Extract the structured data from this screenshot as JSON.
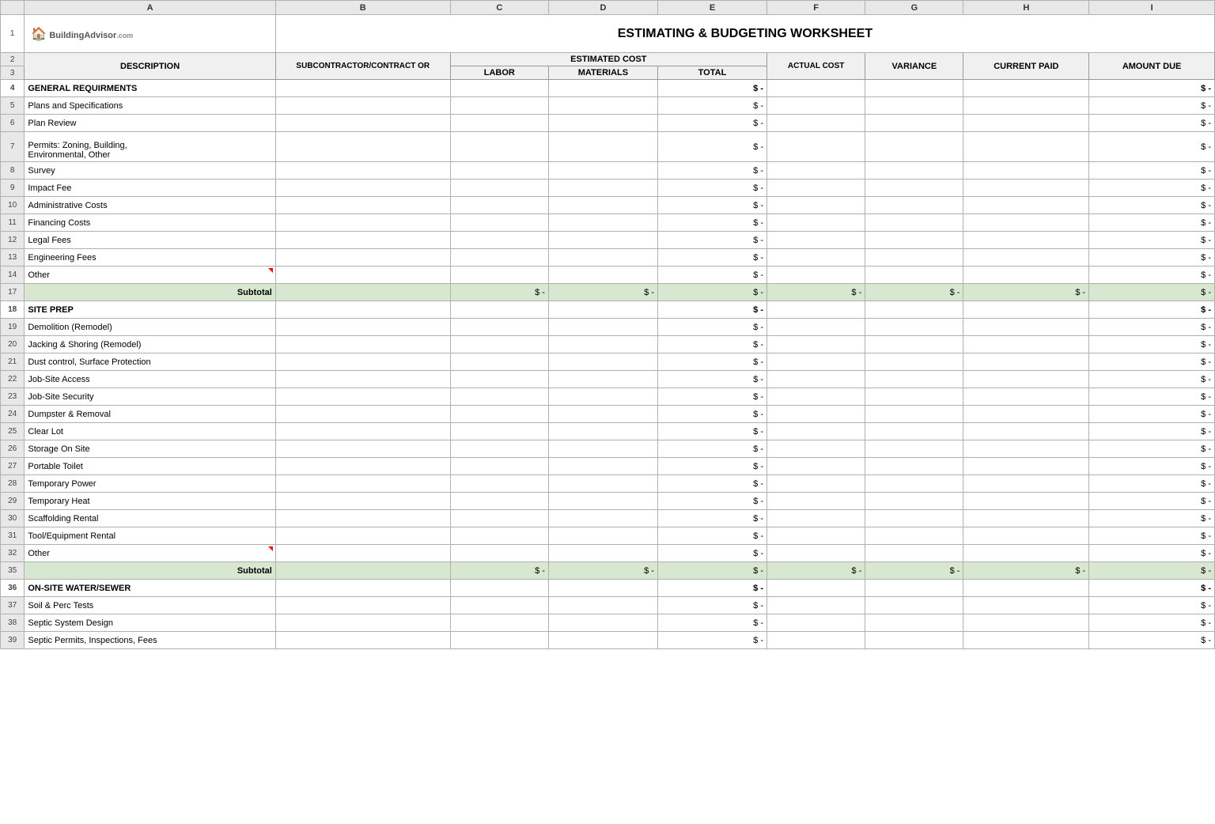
{
  "title": "ESTIMATING & BUDGETING WORKSHEET",
  "logo": {
    "text": "BuildingAdvisor",
    "tld": ".com"
  },
  "columns": {
    "letters": [
      "",
      "A",
      "B",
      "C",
      "D",
      "E",
      "F",
      "G",
      "H",
      "I"
    ],
    "headers": {
      "description": "DESCRIPTION",
      "subcontractor": "SUBCONTRACTOR/CONTRACT OR",
      "estimated_cost": "ESTIMATED COST",
      "labor": "LABOR",
      "materials": "MATERIALS",
      "total": "TOTAL",
      "actual_cost": "ACTUAL COST",
      "variance": "VARIANCE",
      "current_paid": "CURRENT PAID",
      "amount_due": "AMOUNT DUE"
    }
  },
  "rows": [
    {
      "num": "4",
      "label": "GENERAL REQUIRMENTS",
      "bold": true,
      "total": "$ -",
      "amount_due": "$ -"
    },
    {
      "num": "5",
      "label": "Plans and Specifications",
      "bold": false,
      "total": "$ -",
      "amount_due": "$ -"
    },
    {
      "num": "6",
      "label": "Plan Review",
      "bold": false,
      "total": "$ -",
      "amount_due": "$ -"
    },
    {
      "num": "7",
      "label": "Permits: Zoning, Building, Environmental, Other",
      "bold": false,
      "total": "$ -",
      "amount_due": "$ -",
      "multiline": true
    },
    {
      "num": "8",
      "label": "Survey",
      "bold": false,
      "total": "$ -",
      "amount_due": "$ -"
    },
    {
      "num": "9",
      "label": "Impact Fee",
      "bold": false,
      "total": "$ -",
      "amount_due": "$ -"
    },
    {
      "num": "10",
      "label": "Administrative Costs",
      "bold": false,
      "total": "$ -",
      "amount_due": "$ -"
    },
    {
      "num": "11",
      "label": "Financing Costs",
      "bold": false,
      "total": "$ -",
      "amount_due": "$ -"
    },
    {
      "num": "12",
      "label": "Legal Fees",
      "bold": false,
      "total": "$ -",
      "amount_due": "$ -"
    },
    {
      "num": "13",
      "label": "Engineering Fees",
      "bold": false,
      "total": "$ -",
      "amount_due": "$ -"
    },
    {
      "num": "14",
      "label": "Other",
      "bold": false,
      "total": "$ -",
      "amount_due": "$ -",
      "red_triangle": true
    },
    {
      "num": "17",
      "label": "Subtotal",
      "subtotal": true,
      "labor": "$ -",
      "materials": "$ -",
      "total": "$ -",
      "actual": "$ -",
      "variance": "$ -",
      "current_paid": "$ -",
      "amount_due": "$ -"
    },
    {
      "num": "18",
      "label": "SITE PREP",
      "bold": true,
      "total": "$ -",
      "amount_due": "$ -"
    },
    {
      "num": "19",
      "label": "Demolition (Remodel)",
      "bold": false,
      "total": "$ -",
      "amount_due": "$ -"
    },
    {
      "num": "20",
      "label": "Jacking & Shoring (Remodel)",
      "bold": false,
      "total": "$ -",
      "amount_due": "$ -"
    },
    {
      "num": "21",
      "label": "Dust control, Surface Protection",
      "bold": false,
      "total": "$ -",
      "amount_due": "$ -"
    },
    {
      "num": "22",
      "label": "Job-Site Access",
      "bold": false,
      "total": "$ -",
      "amount_due": "$ -"
    },
    {
      "num": "23",
      "label": "Job-Site Security",
      "bold": false,
      "total": "$ -",
      "amount_due": "$ -"
    },
    {
      "num": "24",
      "label": "Dumpster & Removal",
      "bold": false,
      "total": "$ -",
      "amount_due": "$ -"
    },
    {
      "num": "25",
      "label": "Clear Lot",
      "bold": false,
      "total": "$ -",
      "amount_due": "$ -"
    },
    {
      "num": "26",
      "label": "Storage On Site",
      "bold": false,
      "total": "$ -",
      "amount_due": "$ -"
    },
    {
      "num": "27",
      "label": "Portable Toilet",
      "bold": false,
      "total": "$ -",
      "amount_due": "$ -"
    },
    {
      "num": "28",
      "label": "Temporary Power",
      "bold": false,
      "total": "$ -",
      "amount_due": "$ -"
    },
    {
      "num": "29",
      "label": "Temporary Heat",
      "bold": false,
      "total": "$ -",
      "amount_due": "$ -"
    },
    {
      "num": "30",
      "label": "Scaffolding Rental",
      "bold": false,
      "total": "$ -",
      "amount_due": "$ -"
    },
    {
      "num": "31",
      "label": "Tool/Equipment Rental",
      "bold": false,
      "total": "$ -",
      "amount_due": "$ -"
    },
    {
      "num": "32",
      "label": "Other",
      "bold": false,
      "total": "$ -",
      "amount_due": "$ -",
      "red_triangle": true
    },
    {
      "num": "35",
      "label": "Subtotal",
      "subtotal": true,
      "labor": "$ -",
      "materials": "$ -",
      "total": "$ -",
      "actual": "$ -",
      "variance": "$ -",
      "current_paid": "$ -",
      "amount_due": "$ -"
    },
    {
      "num": "36",
      "label": "ON-SITE WATER/SEWER",
      "bold": true,
      "total": "$ -",
      "amount_due": "$ -"
    },
    {
      "num": "37",
      "label": "Soil & Perc Tests",
      "bold": false,
      "total": "$ -",
      "amount_due": "$ -"
    },
    {
      "num": "38",
      "label": "Septic System Design",
      "bold": false,
      "total": "$ -",
      "amount_due": "$ -"
    },
    {
      "num": "39",
      "label": "Septic Permits, Inspections, Fees",
      "bold": false,
      "total": "$ -",
      "amount_due": "$ -"
    }
  ],
  "colors": {
    "header_bg": "#f0f0f0",
    "subtotal_bg": "#d8e8d0",
    "col_header_bg": "#e8e8e8",
    "border": "#b0b0b0"
  }
}
